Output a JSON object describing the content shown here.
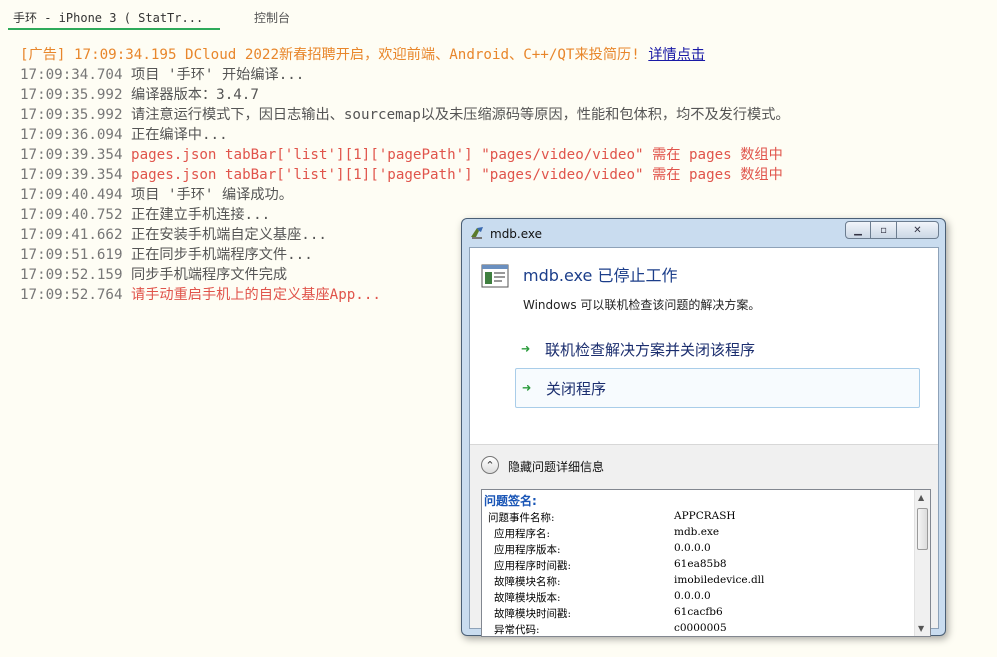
{
  "tabs": {
    "active": "手环 - iPhone 3 ( StatTr...",
    "console": "控制台"
  },
  "log": [
    {
      "ts": "[广告] 17:09:34.195",
      "text": " DCloud 2022新春招聘开启，欢迎前端、Android、C++/QT来投简历! ",
      "link": "详情点击",
      "kind": "ad"
    },
    {
      "ts": "17:09:34.704",
      "text": " 项目 '手环' 开始编译...",
      "kind": "info"
    },
    {
      "ts": "17:09:35.992",
      "text": " 编译器版本：3.4.7",
      "kind": "info"
    },
    {
      "ts": "17:09:35.992",
      "text": " 请注意运行模式下，因日志输出、sourcemap以及未压缩源码等原因，性能和包体积，均不及发行模式。",
      "kind": "info"
    },
    {
      "ts": "17:09:36.094",
      "text": " 正在编译中...",
      "kind": "info"
    },
    {
      "ts": "17:09:39.354",
      "text": " pages.json tabBar['list'][1]['pagePath'] \"pages/video/video\" 需在 pages 数组中",
      "kind": "err"
    },
    {
      "ts": "17:09:39.354",
      "text": " pages.json tabBar['list'][1]['pagePath'] \"pages/video/video\" 需在 pages 数组中",
      "kind": "err"
    },
    {
      "ts": "17:09:40.494",
      "text": " 项目 '手环' 编译成功。",
      "kind": "info"
    },
    {
      "ts": "17:09:40.752",
      "text": " 正在建立手机连接...",
      "kind": "info"
    },
    {
      "ts": "17:09:41.662",
      "text": " 正在安装手机端自定义基座...",
      "kind": "info"
    },
    {
      "ts": "17:09:51.619",
      "text": " 正在同步手机端程序文件...",
      "kind": "info"
    },
    {
      "ts": "17:09:52.159",
      "text": " 同步手机端程序文件完成",
      "kind": "info"
    },
    {
      "ts": "17:09:52.764",
      "text": " 请手动重启手机上的自定义基座App...",
      "kind": "err"
    }
  ],
  "dialog": {
    "window_title": "mdb.exe",
    "heading": "mdb.exe 已停止工作",
    "subtext": "Windows 可以联机检查该问题的解决方案。",
    "option_online": "联机检查解决方案并关闭该程序",
    "option_close": "关闭程序",
    "toggle_label": "隐藏问题详细信息",
    "details_title": "问题签名:",
    "details": [
      {
        "k": "问题事件名称:",
        "v": "APPCRASH",
        "indent": 0
      },
      {
        "k": "应用程序名:",
        "v": "mdb.exe",
        "indent": 1
      },
      {
        "k": "应用程序版本:",
        "v": "0.0.0.0",
        "indent": 1
      },
      {
        "k": "应用程序时间戳:",
        "v": "61ea85b8",
        "indent": 1
      },
      {
        "k": "故障模块名称:",
        "v": "imobiledevice.dll",
        "indent": 1
      },
      {
        "k": "故障模块版本:",
        "v": "0.0.0.0",
        "indent": 1
      },
      {
        "k": "故障模块时间戳:",
        "v": "61cacfb6",
        "indent": 1
      },
      {
        "k": "异常代码:",
        "v": "c0000005",
        "indent": 1
      }
    ]
  },
  "colors": {
    "ad": "#e8862b",
    "error": "#e0544b",
    "info": "#555555",
    "tab_underline": "#2eaa5a",
    "dialog_heading": "#1c3e8a"
  }
}
